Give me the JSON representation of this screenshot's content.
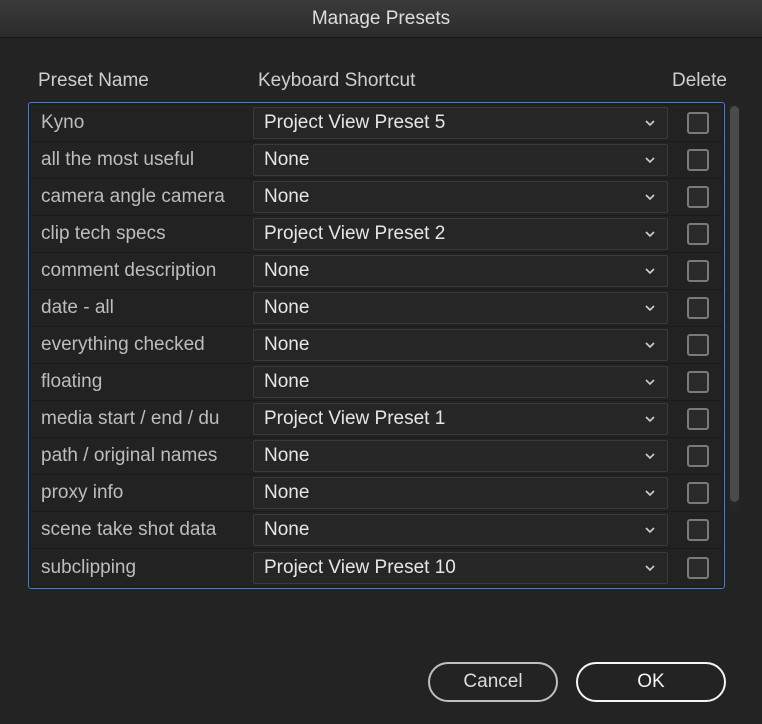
{
  "title": "Manage Presets",
  "columns": {
    "name": "Preset Name",
    "shortcut": "Keyboard Shortcut",
    "delete": "Delete"
  },
  "rows": [
    {
      "name": "Kyno",
      "shortcut": "Project View Preset 5"
    },
    {
      "name": "all the most useful",
      "shortcut": "None"
    },
    {
      "name": "camera angle camera",
      "shortcut": "None"
    },
    {
      "name": "clip tech specs",
      "shortcut": "Project View Preset 2"
    },
    {
      "name": "comment description",
      "shortcut": "None"
    },
    {
      "name": "date - all",
      "shortcut": "None"
    },
    {
      "name": "everything checked",
      "shortcut": "None"
    },
    {
      "name": "floating",
      "shortcut": "None"
    },
    {
      "name": "media start / end / du",
      "shortcut": "Project View Preset 1"
    },
    {
      "name": "path / original names",
      "shortcut": "None"
    },
    {
      "name": "proxy info",
      "shortcut": "None"
    },
    {
      "name": "scene take shot data",
      "shortcut": "None"
    },
    {
      "name": "subclipping",
      "shortcut": "Project View Preset 10"
    }
  ],
  "buttons": {
    "cancel": "Cancel",
    "ok": "OK"
  }
}
